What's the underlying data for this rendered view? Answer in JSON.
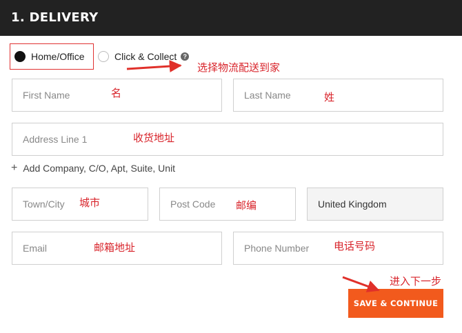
{
  "section": {
    "title": "1. DELIVERY"
  },
  "delivery_options": {
    "home": {
      "label": "Home/Office",
      "selected": true
    },
    "collect": {
      "label": "Click & Collect",
      "selected": false,
      "help_icon": "?"
    }
  },
  "form": {
    "first_name": {
      "placeholder": "First Name",
      "value": ""
    },
    "last_name": {
      "placeholder": "Last Name",
      "value": ""
    },
    "address_line_1": {
      "placeholder": "Address Line 1",
      "value": ""
    },
    "add_company_label": "Add Company, C/O, Apt, Suite, Unit",
    "add_icon": "+",
    "town_city": {
      "placeholder": "Town/City",
      "value": ""
    },
    "post_code": {
      "placeholder": "Post Code",
      "value": ""
    },
    "country": {
      "value": "United Kingdom"
    },
    "email": {
      "placeholder": "Email",
      "value": ""
    },
    "phone_number": {
      "placeholder": "Phone Number",
      "value": ""
    }
  },
  "actions": {
    "save_continue_label": "SAVE & CONTINUE"
  },
  "annotations": {
    "delivery_method": "选择物流配送到家",
    "first_name": "名",
    "last_name": "姓",
    "address": "收货地址",
    "city": "城市",
    "postcode": "邮编",
    "email": "邮箱地址",
    "phone": "电话号码",
    "next_step": "进入下一步"
  },
  "colors": {
    "header_bg": "#222222",
    "accent_orange": "#f25a1d",
    "annotation_red": "#d8232a"
  }
}
